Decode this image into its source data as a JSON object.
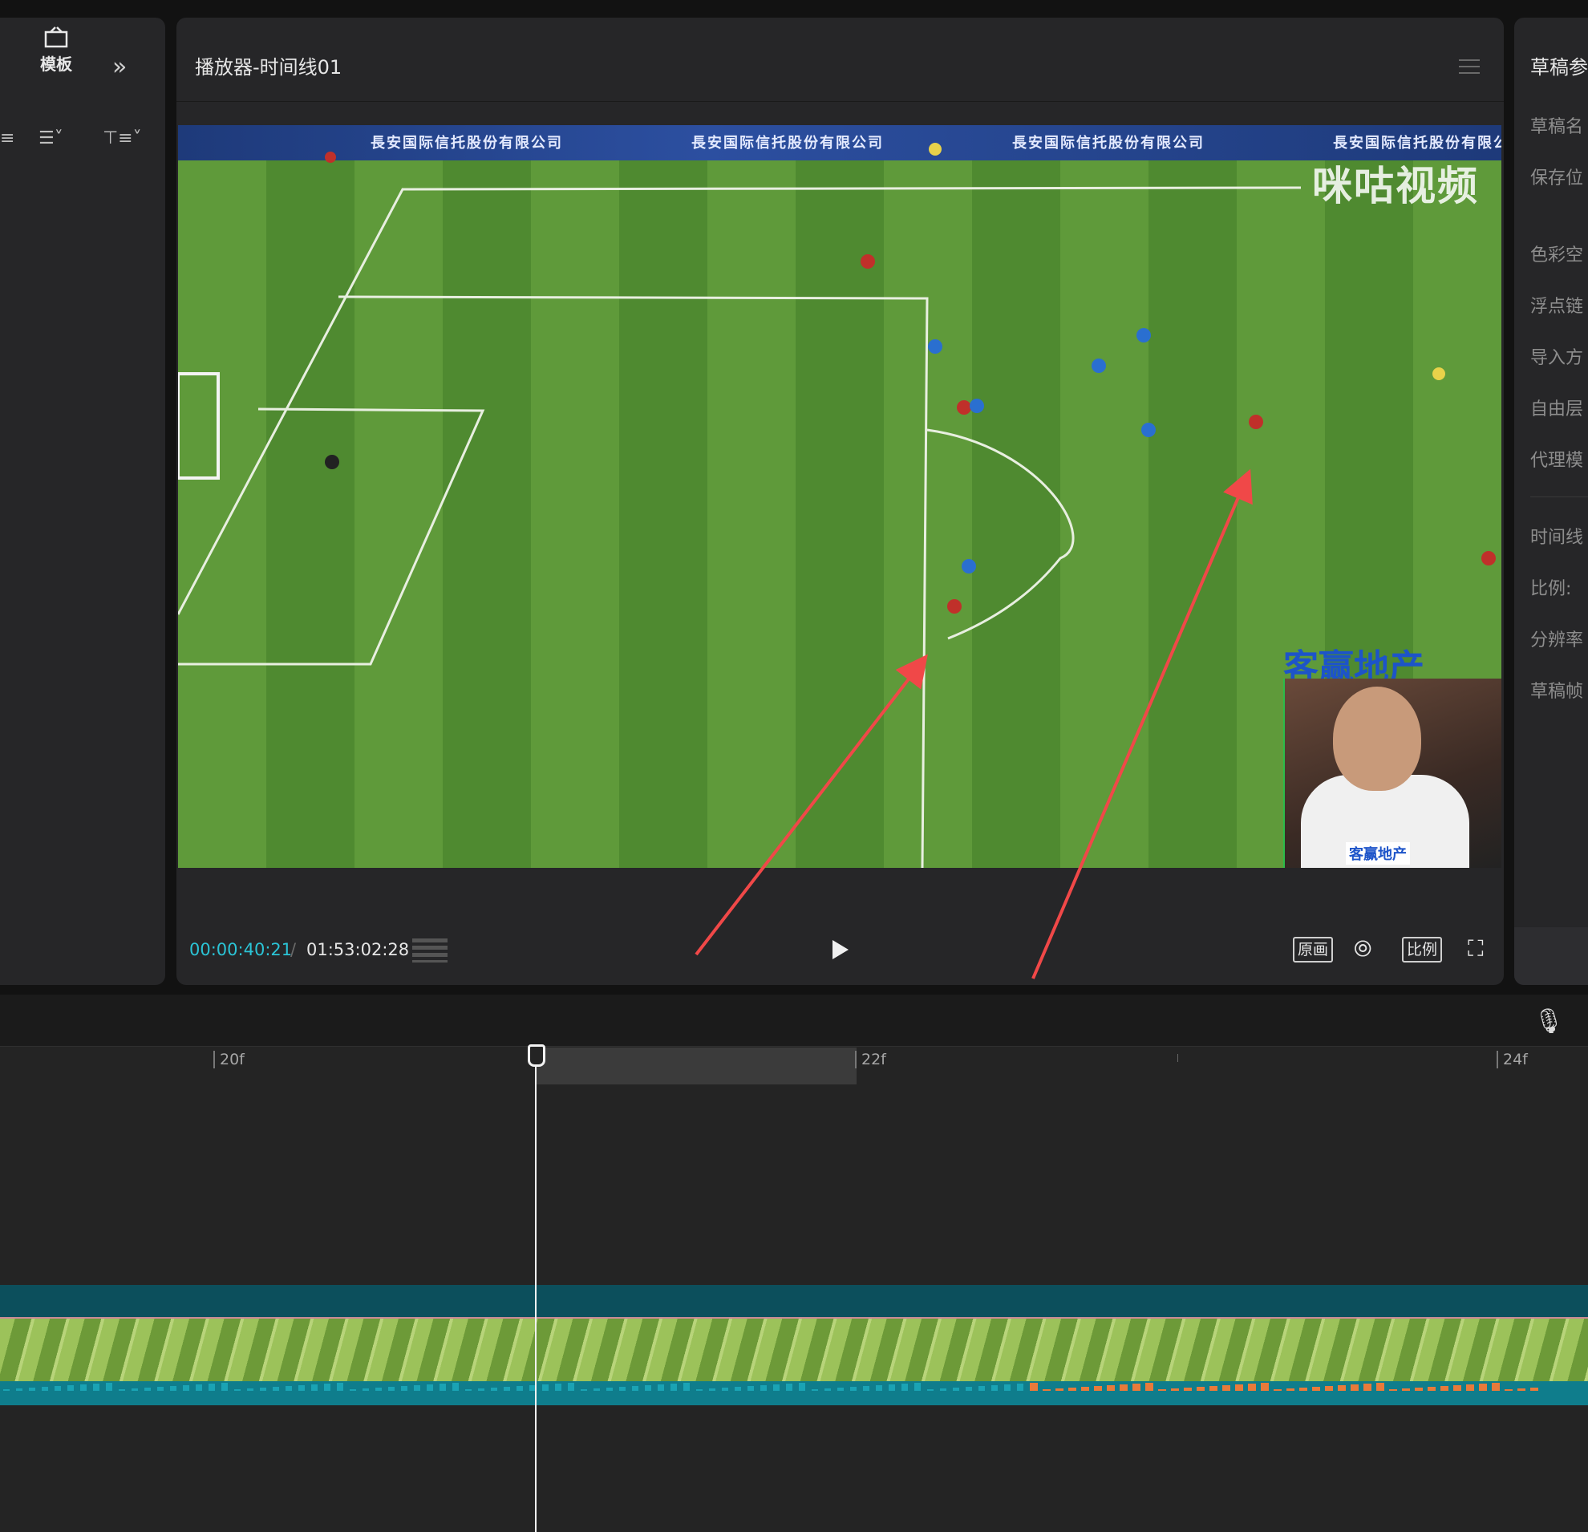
{
  "left_panel": {
    "template_label": "模板",
    "expand_glyph": "»",
    "tool_glyphs": [
      "≡",
      "☰˅",
      "⊤≡˅"
    ]
  },
  "player": {
    "title": "播放器-时间线01",
    "timecode_current": "00:00:40:21",
    "timecode_separator": "/",
    "timecode_total": "01:53:02:28",
    "btn_original": "原画",
    "btn_ratio": "比例",
    "video": {
      "banner_texts": [
        "長安国际信托股份有限公司",
        "長安国际信托股份有限公司",
        "長安国际信托股份有限公司",
        "長安国际信托股份有限公司"
      ],
      "watermark": "咪咕视频",
      "sponsor": "客赢地产",
      "pip_tag": "客赢地产"
    }
  },
  "right_panel": {
    "title": "草稿参",
    "rows": [
      "草稿名",
      "保存位",
      "色彩空",
      "浮点链",
      "导入方",
      "自由层",
      "代理模",
      "时间线",
      "比例:",
      "分辨率",
      "草稿帧"
    ]
  },
  "timeline": {
    "ticks": [
      "20f",
      "22f",
      "24f"
    ]
  },
  "icons": {
    "template": "template-icon",
    "expand": "double-chevron-right-icon",
    "menu": "hamburger-menu-icon",
    "play": "play-icon",
    "zoom": "zoom-fit-icon",
    "fullscreen": "fullscreen-icon",
    "mic": "microphone-icon"
  },
  "colors": {
    "accent_timecode": "#2bc4d6",
    "annotation_arrow": "#f04848",
    "track_teal": "#0c4f5c"
  }
}
